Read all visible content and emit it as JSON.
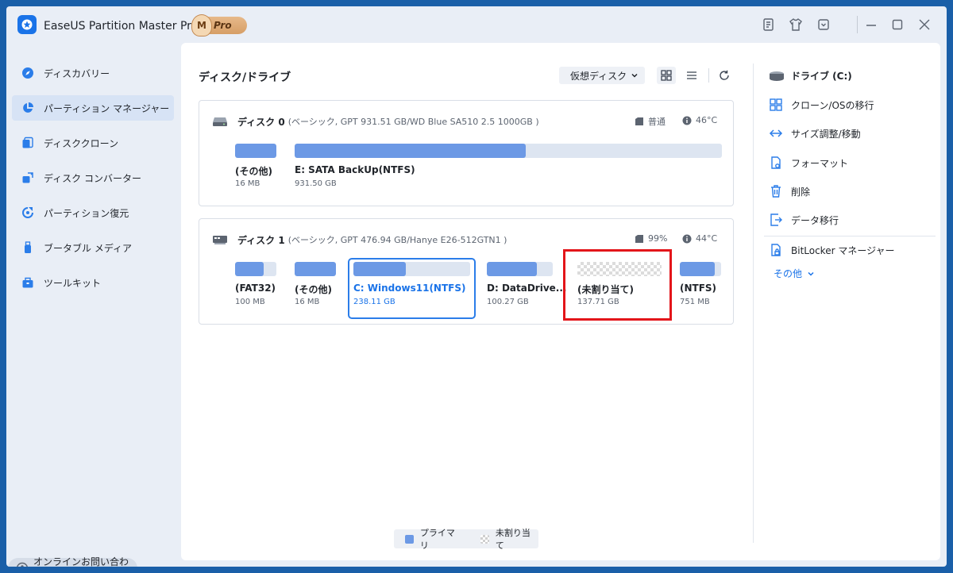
{
  "app": {
    "title": "EaseUS Partition Master Pro版",
    "badge_letter": "M",
    "badge_label": "Pro"
  },
  "sidebar": {
    "items": [
      {
        "label": "ディスカバリー",
        "icon": "compass-icon"
      },
      {
        "label": "パーティション マネージャー",
        "icon": "pie-chart-icon",
        "active": true
      },
      {
        "label": "ディスククローン",
        "icon": "disk-clone-icon"
      },
      {
        "label": "ディスク コンバーター",
        "icon": "disk-convert-icon"
      },
      {
        "label": "パーティション復元",
        "icon": "partition-recovery-icon"
      },
      {
        "label": "ブータブル メディア",
        "icon": "usb-icon"
      },
      {
        "label": "ツールキット",
        "icon": "toolkit-icon"
      }
    ],
    "contact_label": "オンラインお問い合わせ"
  },
  "toolbar": {
    "section_title": "ディスク/ドライブ",
    "virtual_disk_label": "仮想ディスク"
  },
  "disks": [
    {
      "name": "ディスク 0",
      "info": "(ベーシック, GPT 931.51 GB/WD Blue SA510 2.5 1000GB )",
      "health": "普通",
      "temp": "46°C",
      "partitions": [
        {
          "name": "(その他)",
          "size": "16 MB",
          "used": 1.0
        },
        {
          "name": "E: SATA BackUp(NTFS)",
          "size": "931.50 GB",
          "used": 0.54
        }
      ]
    },
    {
      "name": "ディスク 1",
      "info": "(ベーシック, GPT 476.94 GB/Hanye E26-512GTN1 )",
      "health": "99%",
      "temp": "44°C",
      "partitions": [
        {
          "name": "(FAT32)",
          "size": "100 MB",
          "used": 0.7
        },
        {
          "name": "(その他)",
          "size": "16 MB",
          "used": 1.0
        },
        {
          "name": "C: Windows11(NTFS)",
          "size": "238.11 GB",
          "used": 0.45,
          "selected": true
        },
        {
          "name": "D: DataDrive...",
          "size": "100.27 GB",
          "used": 0.76
        },
        {
          "name": "(未割り当て)",
          "size": "137.71 GB",
          "unallocated": true,
          "highlighted": true
        },
        {
          "name": "(NTFS)",
          "size": "751 MB",
          "used": 0.85
        }
      ]
    }
  ],
  "legend": {
    "primary": "プライマリ",
    "unallocated": "未割り当て"
  },
  "right_panel": {
    "drive_title": "ドライブ (C:)",
    "actions": [
      {
        "label": "クローン/OSの移行",
        "icon": "clone-icon"
      },
      {
        "label": "サイズ調整/移動",
        "icon": "resize-icon"
      },
      {
        "label": "フォーマット",
        "icon": "format-icon"
      },
      {
        "label": "削除",
        "icon": "trash-icon"
      },
      {
        "label": "データ移行",
        "icon": "data-migrate-icon"
      },
      {
        "label": "BitLocker マネージャー",
        "icon": "bitlocker-icon"
      }
    ],
    "more_label": "その他"
  },
  "colors": {
    "accent": "#1a73e8",
    "partition_fill": "#6c99e5",
    "highlight_box": "#e3151a"
  }
}
